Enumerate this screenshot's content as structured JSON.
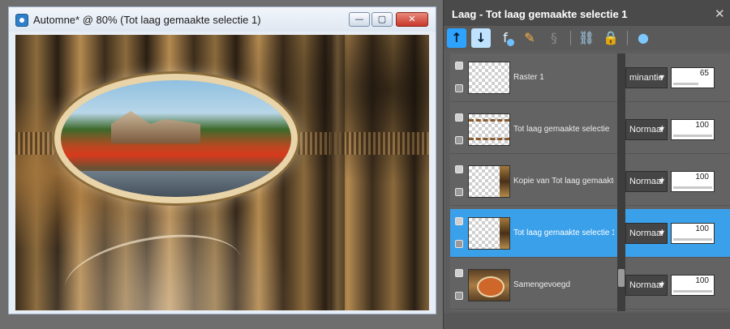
{
  "image_window": {
    "title": "Automne* @  80% (Tot laag gemaakte selectie 1)",
    "buttons": {
      "minimize": "—",
      "maximize": "▢",
      "close": "✕"
    }
  },
  "layers_panel": {
    "title": "Laag - Tot laag gemaakte selectie 1",
    "close_glyph": "✕",
    "toolbar": [
      {
        "name": "move-layer-up-icon",
        "glyph": "↑"
      },
      {
        "name": "move-layer-down-icon",
        "glyph": "↓"
      },
      {
        "name": "layer-effects-icon",
        "glyph": "f"
      },
      {
        "name": "paint-layer-icon",
        "glyph": "✎"
      },
      {
        "name": "link-disabled-icon",
        "glyph": "§"
      },
      {
        "name": "link-layers-icon",
        "glyph": "⛓"
      },
      {
        "name": "lock-icon",
        "glyph": "🔒"
      },
      {
        "name": "mask-icon",
        "glyph": "●"
      }
    ],
    "layers": [
      {
        "name": "Raster 1",
        "blend": "minantie",
        "opacity": "65",
        "opacity_fraction": 0.65,
        "selected": false
      },
      {
        "name": "Tot laag gemaakte selectie",
        "blend": "Normaal",
        "opacity": "100",
        "opacity_fraction": 1.0,
        "selected": false
      },
      {
        "name": "Kopie van Tot laag gemaakte s",
        "blend": "Normaal",
        "opacity": "100",
        "opacity_fraction": 1.0,
        "selected": false
      },
      {
        "name": "Tot laag gemaakte selectie 1",
        "blend": "Normaal",
        "opacity": "100",
        "opacity_fraction": 1.0,
        "selected": true
      },
      {
        "name": "Samengevoegd",
        "blend": "Normaal",
        "opacity": "100",
        "opacity_fraction": 1.0,
        "selected": false
      }
    ]
  }
}
